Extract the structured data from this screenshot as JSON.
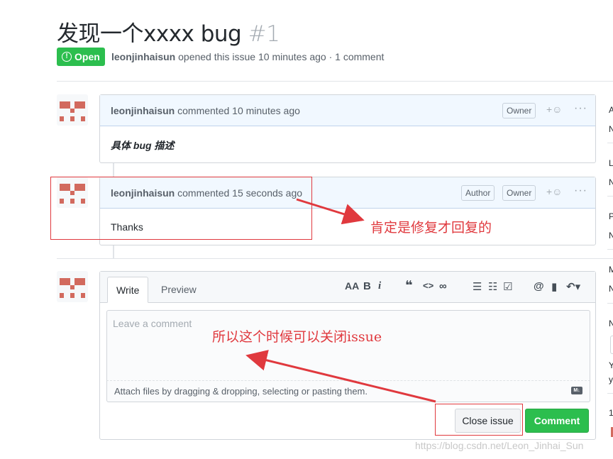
{
  "issue": {
    "title": "发现一个xxxx bug",
    "number": "#1",
    "state": "Open",
    "state_icon": "!",
    "author": "leonjinhaisun",
    "meta_text": " opened this issue 10 minutes ago · 1 comment"
  },
  "comments": [
    {
      "author": "leonjinhaisun",
      "action": " commented 10 minutes ago",
      "badges": [
        "Owner"
      ],
      "body": "具体 bug 描述",
      "reaction": "+☺",
      "menu": "···"
    },
    {
      "author": "leonjinhaisun",
      "action": " commented 15 seconds ago",
      "badges": [
        "Author",
        "Owner"
      ],
      "body": "Thanks",
      "reaction": "+☺",
      "menu": "···"
    }
  ],
  "annotations": {
    "reply_note": "肯定是修复才回复的",
    "close_note": "所以这个时候可以关闭issue"
  },
  "editor": {
    "tab_write": "Write",
    "tab_preview": "Preview",
    "toolbar": {
      "header": "AA",
      "bold": "B",
      "italic": "i",
      "quote": "❝",
      "code": "<>",
      "link": "∞",
      "ul": "☰",
      "ol": "☷",
      "tasklist": "☑",
      "mention": "@",
      "bookmark": "▮",
      "reply": "↶▾"
    },
    "placeholder": "Leave a comment",
    "attach_text": "Attach files by dragging & dropping, selecting or pasting them.",
    "md_badge": "M↓",
    "close_button": "Close issue",
    "comment_button": "Comment"
  },
  "sidebar_fragments": [
    "A",
    "N",
    "L",
    "N",
    "P",
    "N",
    "M",
    "N",
    "N",
    "Y",
    "y",
    "1"
  ],
  "watermark": "https://blog.csdn.net/Leon_Jinhai_Sun",
  "colors": {
    "open_green": "#2cbe4e",
    "annotation_red": "#e0393e",
    "comment_header": "#f1f8ff"
  }
}
